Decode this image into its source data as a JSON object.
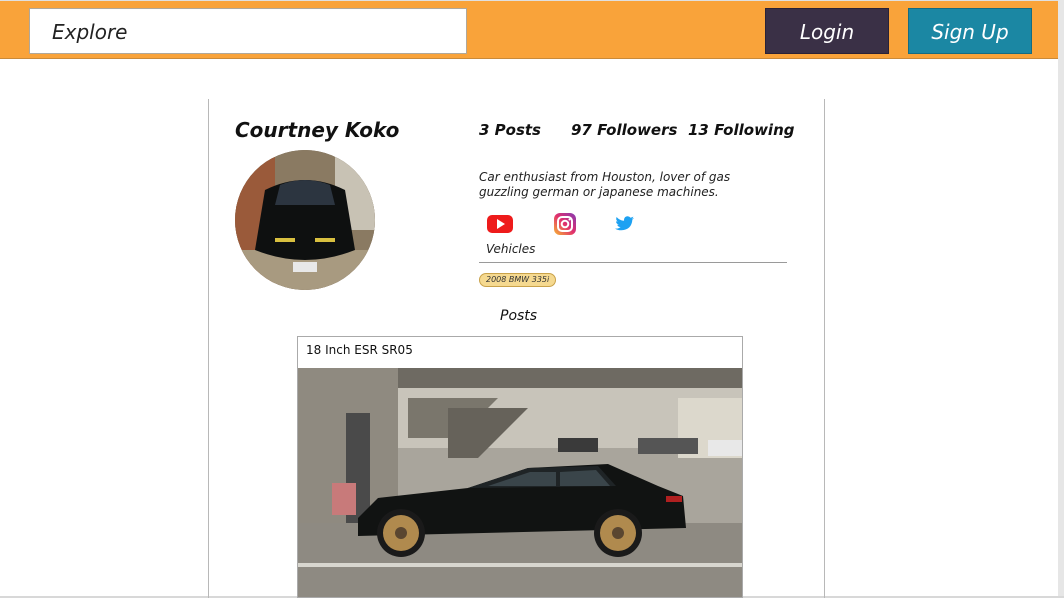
{
  "header": {
    "search_text": "Explore",
    "login_label": "Login",
    "signup_label": "Sign Up",
    "bar_color": "#f9a33a",
    "login_color": "#3a3046",
    "signup_color": "#1b87a3"
  },
  "profile": {
    "name": "Courtney Koko",
    "posts_count": "3 Posts",
    "followers_count": "97 Followers",
    "following_count": "13 Following",
    "bio": "Car enthusiast from Houston, lover of gas guzzling german or japanese machines.",
    "social_icons": [
      "youtube-icon",
      "instagram-icon",
      "twitter-icon"
    ],
    "vehicles_label": "Vehicles",
    "vehicles": [
      "2008 BMW 335i"
    ]
  },
  "posts": {
    "heading": "Posts",
    "items": [
      {
        "title": "18 Inch ESR SR05"
      }
    ]
  }
}
